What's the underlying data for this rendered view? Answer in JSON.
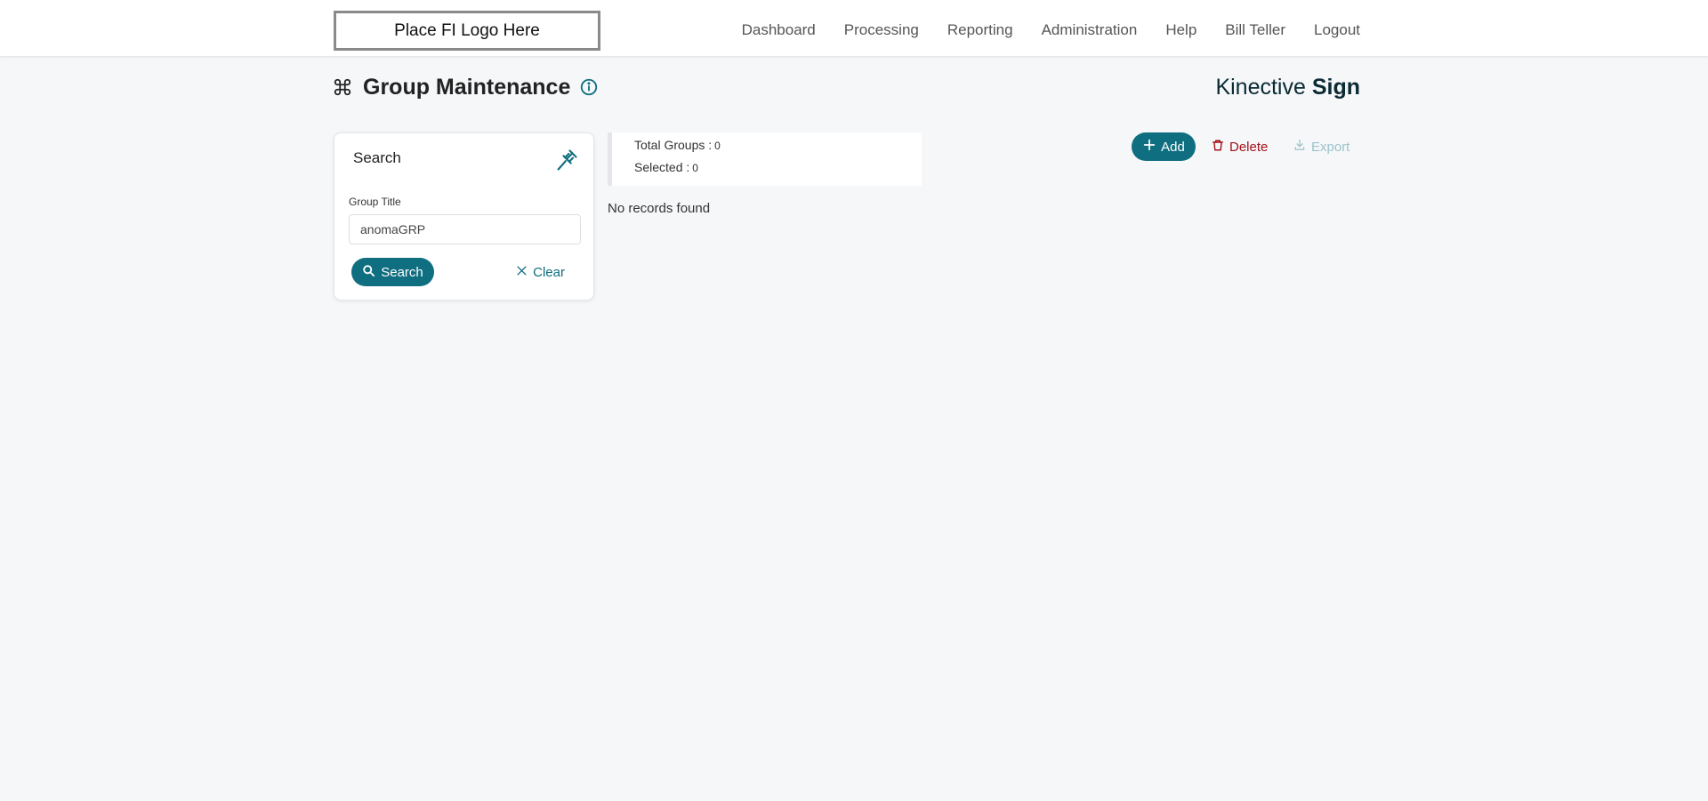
{
  "header": {
    "logo_text": "Place FI Logo Here",
    "nav": [
      {
        "label": "Dashboard"
      },
      {
        "label": "Processing"
      },
      {
        "label": "Reporting"
      },
      {
        "label": "Administration"
      },
      {
        "label": "Help"
      },
      {
        "label": "Bill Teller"
      },
      {
        "label": "Logout"
      }
    ]
  },
  "page": {
    "title": "Group Maintenance",
    "title_icon": "command-icon",
    "info_icon": "info-icon",
    "brand_light": "Kinective ",
    "brand_bold": "Sign"
  },
  "search_panel": {
    "title": "Search",
    "pin_icon": "pin-icon",
    "group_title_label": "Group Title",
    "group_title_value": "anomaGRP",
    "search_button": "Search",
    "clear_button": "Clear"
  },
  "summary": {
    "total_label": "Total Groups :",
    "total_value": "0",
    "selected_label": "Selected :",
    "selected_value": "0",
    "empty_message": "No records found"
  },
  "actions": {
    "add": "Add",
    "delete": "Delete",
    "export": "Export"
  },
  "colors": {
    "accent": "#0f6e80",
    "danger": "#a3121b",
    "disabled": "#9cc3cc",
    "background": "#f5f7f9"
  }
}
